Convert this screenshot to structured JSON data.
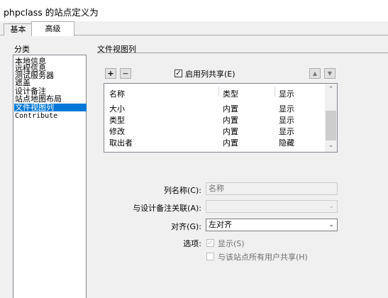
{
  "window": {
    "title": "phpclass 的站点定义为"
  },
  "tabs": [
    {
      "label": "基本"
    },
    {
      "label": "高级"
    }
  ],
  "category": {
    "label": "分类",
    "items": [
      {
        "label": "本地信息"
      },
      {
        "label": "远程信息"
      },
      {
        "label": "测试服务器"
      },
      {
        "label": "遮盖"
      },
      {
        "label": "设计备注"
      },
      {
        "label": "站点地图布局"
      },
      {
        "label": "文件视图列"
      },
      {
        "label": "Contribute"
      }
    ],
    "selected": "文件视图列"
  },
  "section": {
    "title": "文件视图列",
    "add_label": "+",
    "remove_label": "−",
    "enable_sharing_label": "启用列共享(E)",
    "enable_sharing_checked": true,
    "up_label": "▲",
    "down_label": "▼"
  },
  "columns_table": {
    "headers": [
      "名称",
      "类型",
      "显示"
    ],
    "rows": [
      {
        "name": "大小",
        "type": "内置",
        "show": "显示"
      },
      {
        "name": "类型",
        "type": "内置",
        "show": "显示"
      },
      {
        "name": "修改",
        "type": "内置",
        "show": "显示"
      },
      {
        "name": "取出者",
        "type": "内置",
        "show": "隐藏"
      }
    ]
  },
  "form": {
    "column_name_label": "列名称(C):",
    "column_name_value": "名称",
    "design_note_label": "与设计备注关联(A):",
    "design_note_value": "",
    "align_label": "对齐(G):",
    "align_value": "左对齐",
    "options_label": "选项:",
    "show_label": "显示(S)",
    "show_checked": true,
    "share_all_label": "与该站点所有用户共享(H)",
    "share_all_checked": false
  }
}
